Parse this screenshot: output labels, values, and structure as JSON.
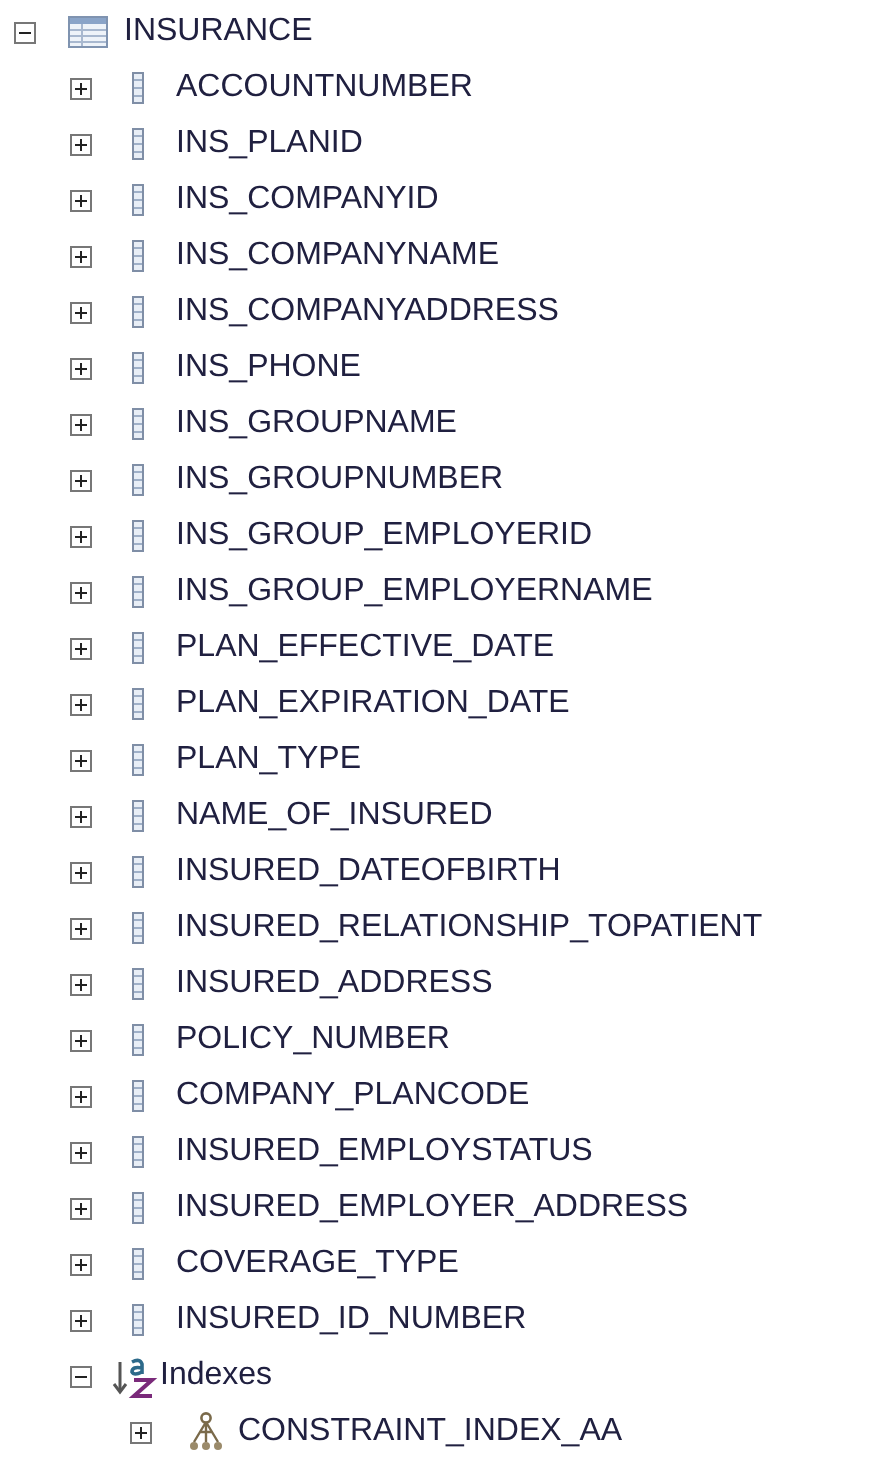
{
  "tree": [
    {
      "kind": "table",
      "label": "INSURANCE",
      "expanded": true,
      "children": [
        {
          "kind": "column",
          "label": "ACCOUNTNUMBER",
          "expanded": false
        },
        {
          "kind": "column",
          "label": "INS_PLANID",
          "expanded": false
        },
        {
          "kind": "column",
          "label": "INS_COMPANYID",
          "expanded": false
        },
        {
          "kind": "column",
          "label": "INS_COMPANYNAME",
          "expanded": false
        },
        {
          "kind": "column",
          "label": "INS_COMPANYADDRESS",
          "expanded": false
        },
        {
          "kind": "column",
          "label": "INS_PHONE",
          "expanded": false
        },
        {
          "kind": "column",
          "label": "INS_GROUPNAME",
          "expanded": false
        },
        {
          "kind": "column",
          "label": "INS_GROUPNUMBER",
          "expanded": false
        },
        {
          "kind": "column",
          "label": "INS_GROUP_EMPLOYERID",
          "expanded": false
        },
        {
          "kind": "column",
          "label": "INS_GROUP_EMPLOYERNAME",
          "expanded": false
        },
        {
          "kind": "column",
          "label": "PLAN_EFFECTIVE_DATE",
          "expanded": false
        },
        {
          "kind": "column",
          "label": "PLAN_EXPIRATION_DATE",
          "expanded": false
        },
        {
          "kind": "column",
          "label": "PLAN_TYPE",
          "expanded": false
        },
        {
          "kind": "column",
          "label": "NAME_OF_INSURED",
          "expanded": false
        },
        {
          "kind": "column",
          "label": "INSURED_DATEOFBIRTH",
          "expanded": false
        },
        {
          "kind": "column",
          "label": "INSURED_RELATIONSHIP_TOPATIENT",
          "expanded": false
        },
        {
          "kind": "column",
          "label": "INSURED_ADDRESS",
          "expanded": false
        },
        {
          "kind": "column",
          "label": "POLICY_NUMBER",
          "expanded": false
        },
        {
          "kind": "column",
          "label": "COMPANY_PLANCODE",
          "expanded": false
        },
        {
          "kind": "column",
          "label": "INSURED_EMPLOYSTATUS",
          "expanded": false
        },
        {
          "kind": "column",
          "label": "INSURED_EMPLOYER_ADDRESS",
          "expanded": false
        },
        {
          "kind": "column",
          "label": "COVERAGE_TYPE",
          "expanded": false
        },
        {
          "kind": "column",
          "label": "INSURED_ID_NUMBER",
          "expanded": false
        },
        {
          "kind": "indexes",
          "label": "Indexes",
          "expanded": true,
          "children": [
            {
              "kind": "index",
              "label": "CONSTRAINT_INDEX_AA",
              "expanded": false
            }
          ]
        }
      ]
    }
  ]
}
